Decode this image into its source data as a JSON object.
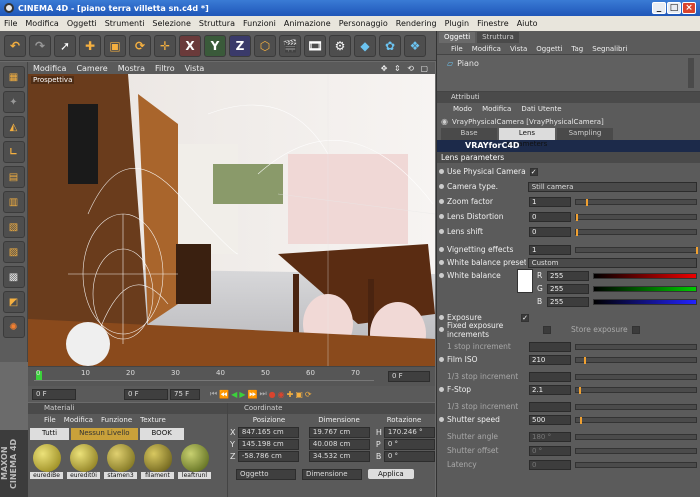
{
  "window": {
    "title": "CINEMA 4D - [piano terra villetta sn.c4d *]"
  },
  "menu": [
    "File",
    "Modifica",
    "Oggetti",
    "Strumenti",
    "Selezione",
    "Struttura",
    "Funzioni",
    "Animazione",
    "Personaggio",
    "Rendering",
    "Plugin",
    "Finestre",
    "Aiuto"
  ],
  "viewport_menu": [
    "Modifica",
    "Camere",
    "Mostra",
    "Filtro",
    "Vista"
  ],
  "viewport_label": "Prospettiva",
  "timeline": {
    "ticks": [
      "0",
      "10",
      "20",
      "30",
      "40",
      "50",
      "60",
      "70"
    ],
    "frame": "0 F",
    "start": "0 F",
    "end": "75 F",
    "current": "0 F"
  },
  "materials": {
    "title": "Materiali",
    "menu": [
      "File",
      "Modifica",
      "Funzione",
      "Texture"
    ],
    "tabs": [
      "Tutti",
      "Nessun Livello",
      "BOOK"
    ],
    "items": [
      "eurediBe",
      "euredit0i",
      "stamen3",
      "filament",
      "leaftrunl"
    ]
  },
  "coords": {
    "title": "Coordinate",
    "headers": [
      "Posizione",
      "Dimensione",
      "Rotazione"
    ],
    "rows": [
      {
        "axis": "X",
        "pos": "847.165 cm",
        "dim": "19.767 cm",
        "rot_axis": "H",
        "rot": "170.246 °"
      },
      {
        "axis": "Y",
        "pos": "145.198 cm",
        "dim": "40.008 cm",
        "rot_axis": "P",
        "rot": "0 °"
      },
      {
        "axis": "Z",
        "pos": "-58.786 cm",
        "dim": "34.532 cm",
        "rot_axis": "B",
        "rot": "0 °"
      }
    ],
    "mode1": "Oggetto",
    "mode2": "Dimensione",
    "apply": "Applica"
  },
  "objects": {
    "tabs": [
      "Oggetti",
      "Struttura"
    ],
    "menu": [
      "File",
      "Modifica",
      "Vista",
      "Oggetti",
      "Tag",
      "Segnalibri"
    ],
    "item": "Piano"
  },
  "attributes": {
    "title": "Attributi",
    "menu": [
      "Modo",
      "Modifica",
      "Dati Utente"
    ],
    "object": "VrayPhysicalCamera [VrayPhysicalCamera]",
    "tabs": [
      "Base",
      "Lens parameters",
      "Sampling"
    ],
    "logo": "VRAYforC4D",
    "section": "Lens parameters"
  },
  "params": {
    "use_physical": "Use Physical Camera",
    "camera_type_label": "Camera type.",
    "camera_type": "Still camera",
    "zoom_label": "Zoom factor",
    "zoom": "1",
    "distortion_label": "Lens Distortion",
    "distortion": "0",
    "shift_label": "Lens shift",
    "shift": "0",
    "vignetting_label": "Vignetting effects",
    "vignetting": "1",
    "wb_presets_label": "White balance presets",
    "wb_presets": "Custom",
    "wb_label": "White balance",
    "r": "255",
    "g": "255",
    "b": "255",
    "exposure_label": "Exposure",
    "fixed_label": "Fixed exposure increments",
    "store_label": "Store exposure",
    "stop_label": "1 stop increment",
    "iso_label": "Film ISO",
    "iso": "210",
    "third_label": "1/3 stop increment",
    "fstop_label": "F-Stop",
    "fstop": "2.1",
    "third2_label": "1/3 stop increment",
    "shutter_label": "Shutter speed",
    "shutter": "500",
    "angle_label": "Shutter angle",
    "angle": "180 °",
    "offset_label": "Shutter offset",
    "offset": "0 °",
    "latency_label": "Latency",
    "latency": "0"
  }
}
